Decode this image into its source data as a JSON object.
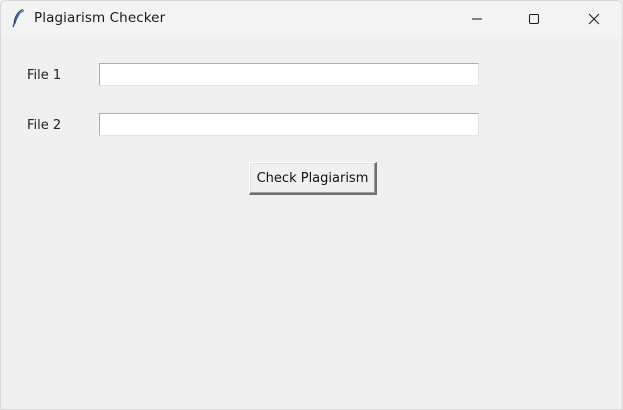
{
  "window": {
    "title": "Plagiarism Checker",
    "app_icon": "feather-icon",
    "controls": {
      "minimize_icon": "minimize-icon",
      "maximize_icon": "maximize-icon",
      "close_icon": "close-icon"
    }
  },
  "form": {
    "file1": {
      "label": "File 1",
      "value": ""
    },
    "file2": {
      "label": "File 2",
      "value": ""
    },
    "submit_label": "Check Plagiarism"
  }
}
